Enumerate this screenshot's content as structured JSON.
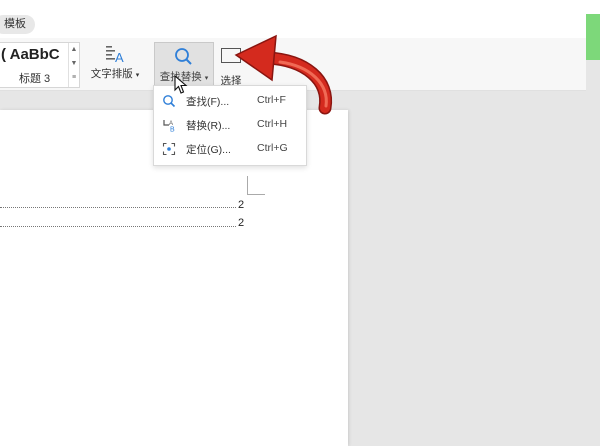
{
  "top": {
    "template_tab": "模板"
  },
  "ribbon": {
    "style_sample": "( AaBbC",
    "style_name": "标题 3",
    "typeset_label": "文字排版",
    "find_replace_label": "查找替换",
    "select_label": "选择"
  },
  "menu": {
    "items": [
      {
        "label": "查找(F)...",
        "shortcut": "Ctrl+F",
        "icon": "magnifier-icon"
      },
      {
        "label": "替换(R)...",
        "shortcut": "Ctrl+H",
        "icon": "replace-icon"
      },
      {
        "label": "定位(G)...",
        "shortcut": "Ctrl+G",
        "icon": "locate-icon"
      }
    ]
  },
  "document": {
    "toc_pages": [
      "2",
      "2"
    ]
  },
  "colors": {
    "arrow": "#d42a1e",
    "accent_blue": "#2f7fd8",
    "side_bar": "#7dd87a"
  }
}
